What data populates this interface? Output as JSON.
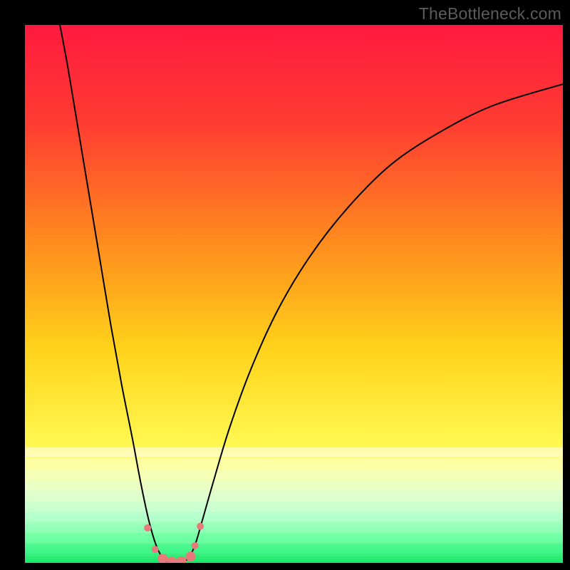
{
  "watermark": "TheBottleneck.com",
  "chart_data": {
    "type": "line",
    "title": "",
    "xlabel": "",
    "ylabel": "",
    "xlim": [
      0,
      100
    ],
    "ylim": [
      0,
      100
    ],
    "background_gradient": {
      "stops": [
        {
          "offset": 0,
          "color": "#ff1a3f"
        },
        {
          "offset": 18,
          "color": "#ff3b32"
        },
        {
          "offset": 40,
          "color": "#ff8a1e"
        },
        {
          "offset": 60,
          "color": "#ffd21a"
        },
        {
          "offset": 78,
          "color": "#fff850"
        },
        {
          "offset": 83,
          "color": "#fbffa0"
        },
        {
          "offset": 87,
          "color": "#eaffc8"
        },
        {
          "offset": 91,
          "color": "#c8ffd0"
        },
        {
          "offset": 95,
          "color": "#7effa0"
        },
        {
          "offset": 100,
          "color": "#17e86a"
        }
      ],
      "horizontal_bands": [
        {
          "y": 78.5,
          "color": "#fffef0"
        },
        {
          "y": 80.5,
          "color": "#fcffb8"
        },
        {
          "y": 82.5,
          "color": "#f4ffc4"
        },
        {
          "y": 84.5,
          "color": "#e8ffcc"
        },
        {
          "y": 86.5,
          "color": "#d8ffd0"
        },
        {
          "y": 88.5,
          "color": "#c4ffd0"
        },
        {
          "y": 90.5,
          "color": "#acffcc"
        },
        {
          "y": 92.5,
          "color": "#8effbe"
        },
        {
          "y": 94.5,
          "color": "#6affac"
        },
        {
          "y": 96.5,
          "color": "#40f890"
        }
      ]
    },
    "series": [
      {
        "name": "bottleneck-curve",
        "color": "#000000",
        "points": [
          {
            "x": 6.5,
            "y": 100
          },
          {
            "x": 8.0,
            "y": 92
          },
          {
            "x": 10.0,
            "y": 80
          },
          {
            "x": 12.0,
            "y": 68
          },
          {
            "x": 14.0,
            "y": 56
          },
          {
            "x": 16.0,
            "y": 44
          },
          {
            "x": 18.0,
            "y": 33
          },
          {
            "x": 20.0,
            "y": 23
          },
          {
            "x": 21.5,
            "y": 15
          },
          {
            "x": 23.0,
            "y": 8
          },
          {
            "x": 24.5,
            "y": 3
          },
          {
            "x": 26.0,
            "y": 0.5
          },
          {
            "x": 28.0,
            "y": 0
          },
          {
            "x": 30.0,
            "y": 0.5
          },
          {
            "x": 31.5,
            "y": 3
          },
          {
            "x": 33.0,
            "y": 8
          },
          {
            "x": 35.0,
            "y": 15
          },
          {
            "x": 38.0,
            "y": 25
          },
          {
            "x": 42.0,
            "y": 36
          },
          {
            "x": 47.0,
            "y": 47
          },
          {
            "x": 53.0,
            "y": 57
          },
          {
            "x": 60.0,
            "y": 66
          },
          {
            "x": 68.0,
            "y": 74
          },
          {
            "x": 77.0,
            "y": 80
          },
          {
            "x": 87.0,
            "y": 85
          },
          {
            "x": 100.0,
            "y": 89
          }
        ]
      }
    ],
    "markers": {
      "color": "#e77b7b",
      "radius_small": 5,
      "radius_large": 7,
      "points": [
        {
          "x": 22.8,
          "y": 6.5,
          "r": "small"
        },
        {
          "x": 24.2,
          "y": 2.5,
          "r": "small"
        },
        {
          "x": 25.6,
          "y": 0.8,
          "r": "large"
        },
        {
          "x": 27.3,
          "y": 0.2,
          "r": "large"
        },
        {
          "x": 29.1,
          "y": 0.3,
          "r": "large"
        },
        {
          "x": 30.8,
          "y": 1.2,
          "r": "large"
        },
        {
          "x": 31.6,
          "y": 3.2,
          "r": "small"
        },
        {
          "x": 32.6,
          "y": 6.8,
          "r": "small"
        }
      ]
    }
  }
}
